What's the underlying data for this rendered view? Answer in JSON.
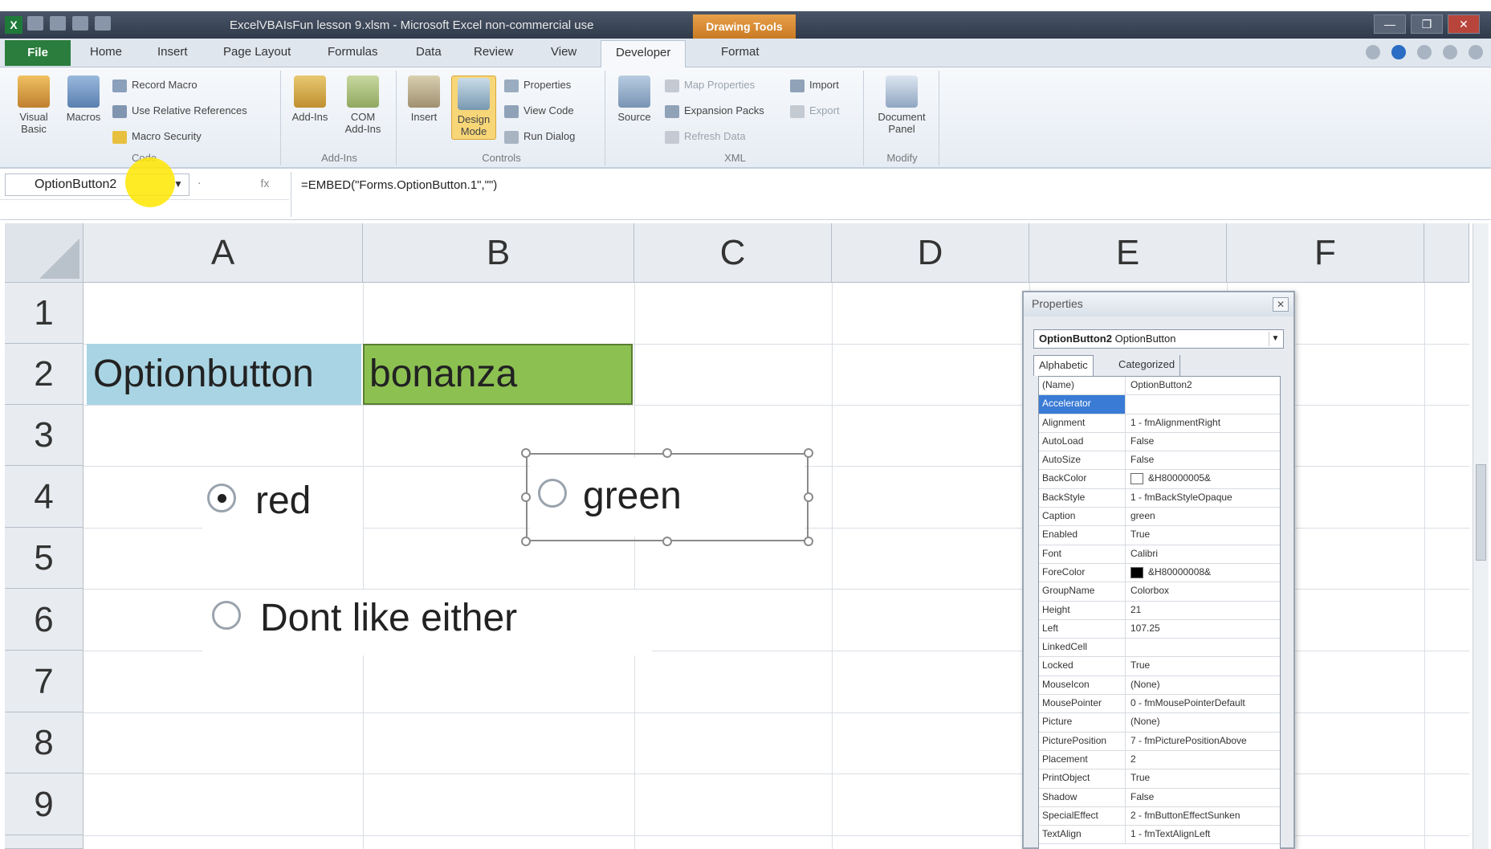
{
  "window": {
    "title": "ExcelVBAIsFun lesson 9.xlsm - Microsoft Excel non-commercial use",
    "app_icon": "X",
    "context_tab": "Drawing Tools",
    "controls": [
      "minimize",
      "restore",
      "close"
    ]
  },
  "tabs": [
    {
      "label": "File"
    },
    {
      "label": "Home"
    },
    {
      "label": "Insert"
    },
    {
      "label": "Page Layout"
    },
    {
      "label": "Formulas"
    },
    {
      "label": "Data"
    },
    {
      "label": "Review"
    },
    {
      "label": "View"
    },
    {
      "label": "Developer",
      "active": true
    },
    {
      "label": "Format"
    }
  ],
  "ribbon": {
    "code": {
      "label": "Code",
      "visual_basic": "Visual Basic",
      "macros": "Macros",
      "record_macro": "Record Macro",
      "relative_refs": "Use Relative References",
      "macro_security": "Macro Security"
    },
    "addins": {
      "label": "Add-Ins",
      "addins": "Add-Ins",
      "com_addins": "COM Add-Ins"
    },
    "controls": {
      "label": "Controls",
      "insert": "Insert",
      "design_mode": "Design Mode",
      "properties": "Properties",
      "view_code": "View Code",
      "run_dialog": "Run Dialog"
    },
    "xml": {
      "label": "XML",
      "source": "Source",
      "map_properties": "Map Properties",
      "expansion_packs": "Expansion Packs",
      "refresh_data": "Refresh Data",
      "import": "Import",
      "export": "Export"
    },
    "modify": {
      "label": "Modify",
      "document_panel": "Document Panel"
    }
  },
  "formula_bar": {
    "name_box": "OptionButton2",
    "formula": "=EMBED(\"Forms.OptionButton.1\",\"\")",
    "fx": "fx"
  },
  "sheet": {
    "columns": [
      "A",
      "B",
      "C",
      "D",
      "E",
      "F"
    ],
    "rows": [
      "1",
      "2",
      "3",
      "4",
      "5",
      "6",
      "7",
      "8",
      "9"
    ],
    "cells": {
      "A2": "Optionbutton",
      "B2": "bonanza"
    },
    "option_buttons": [
      {
        "caption": "red",
        "checked": true
      },
      {
        "caption": "green",
        "checked": false,
        "selected": true
      },
      {
        "caption": "Dont like either",
        "checked": false
      }
    ]
  },
  "properties": {
    "title": "Properties",
    "object_name": "OptionButton2",
    "object_type": "OptionButton",
    "tab_alphabetic": "Alphabetic",
    "tab_categorized": "Categorized",
    "rows": [
      {
        "name": "(Name)",
        "value": "OptionButton2"
      },
      {
        "name": "Accelerator",
        "value": "",
        "highlight": true
      },
      {
        "name": "Alignment",
        "value": "1 - fmAlignmentRight"
      },
      {
        "name": "AutoLoad",
        "value": "False"
      },
      {
        "name": "AutoSize",
        "value": "False"
      },
      {
        "name": "BackColor",
        "value": "&H80000005&",
        "swatch": "#ffffff"
      },
      {
        "name": "BackStyle",
        "value": "1 - fmBackStyleOpaque"
      },
      {
        "name": "Caption",
        "value": "green"
      },
      {
        "name": "Enabled",
        "value": "True"
      },
      {
        "name": "Font",
        "value": "Calibri"
      },
      {
        "name": "ForeColor",
        "value": "&H80000008&",
        "swatch": "#000000"
      },
      {
        "name": "GroupName",
        "value": "Colorbox"
      },
      {
        "name": "Height",
        "value": "21"
      },
      {
        "name": "Left",
        "value": "107.25"
      },
      {
        "name": "LinkedCell",
        "value": ""
      },
      {
        "name": "Locked",
        "value": "True"
      },
      {
        "name": "MouseIcon",
        "value": "(None)"
      },
      {
        "name": "MousePointer",
        "value": "0 - fmMousePointerDefault"
      },
      {
        "name": "Picture",
        "value": "(None)"
      },
      {
        "name": "PicturePosition",
        "value": "7 - fmPicturePositionAbove"
      },
      {
        "name": "Placement",
        "value": "2"
      },
      {
        "name": "PrintObject",
        "value": "True"
      },
      {
        "name": "Shadow",
        "value": "False"
      },
      {
        "name": "SpecialEffect",
        "value": "2 - fmButtonEffectSunken"
      },
      {
        "name": "TextAlign",
        "value": "1 - fmTextAlignLeft"
      }
    ]
  },
  "colors": {
    "cell_a2_fill": "#a9d4e3",
    "cell_b2_fill": "#8cc152",
    "file_tab": "#2a7d3c",
    "context_tab": "#e8a04a",
    "highlight": "#3a7bd5"
  }
}
